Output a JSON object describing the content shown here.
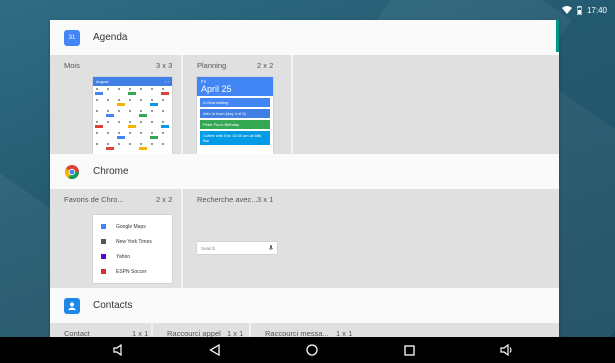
{
  "status_bar": {
    "time": "17:40",
    "icons": [
      "wifi-icon",
      "battery-icon"
    ]
  },
  "apps": [
    {
      "name": "Agenda",
      "icon": "calendar-icon",
      "icon_text": "31",
      "icon_color": "#4285f4",
      "widgets": [
        {
          "label": "Mois",
          "size": "3 x 3",
          "preview": {
            "month_title": "August"
          }
        },
        {
          "label": "Planning",
          "size": "2 x 2",
          "preview": {
            "day": "Fri",
            "date": "April 25",
            "events": [
              {
                "text": "A Gina visiting",
                "color": "#4285f4"
              },
              {
                "text": "Alex in town (day 4 of 5)",
                "color": "#3f7fe6"
              },
              {
                "text": "Peter Foo's Birthday",
                "color": "#34a853"
              },
              {
                "text": "Coffee with Eric 10:00 am at Milk Bar",
                "color": "#039be5"
              }
            ]
          }
        }
      ]
    },
    {
      "name": "Chrome",
      "icon": "chrome-icon",
      "widgets": [
        {
          "label": "Favoris de Chro...",
          "size": "2 x 2",
          "preview": {
            "bookmarks": [
              {
                "text": "Google Maps",
                "color": "#4285f4"
              },
              {
                "text": "New York Times",
                "color": "#555555"
              },
              {
                "text": "Yahoo",
                "color": "#5f01d1"
              },
              {
                "text": "ESPN Soccer",
                "color": "#d32f2f"
              }
            ]
          }
        },
        {
          "label": "Recherche avec...",
          "size": "3 x 1",
          "preview": {
            "placeholder": "Search"
          }
        }
      ]
    },
    {
      "name": "Contacts",
      "icon": "contacts-icon",
      "icon_color": "#1e88e5",
      "widgets": [
        {
          "label": "Contact",
          "size": "1 x 1"
        },
        {
          "label": "Raccourci appel",
          "size": "1 x 1"
        },
        {
          "label": "Raccourci messa...",
          "size": "1 x 1"
        }
      ]
    }
  ],
  "nav_bar": [
    "volume-down-icon",
    "back-icon",
    "home-icon",
    "recents-icon",
    "volume-up-icon"
  ]
}
